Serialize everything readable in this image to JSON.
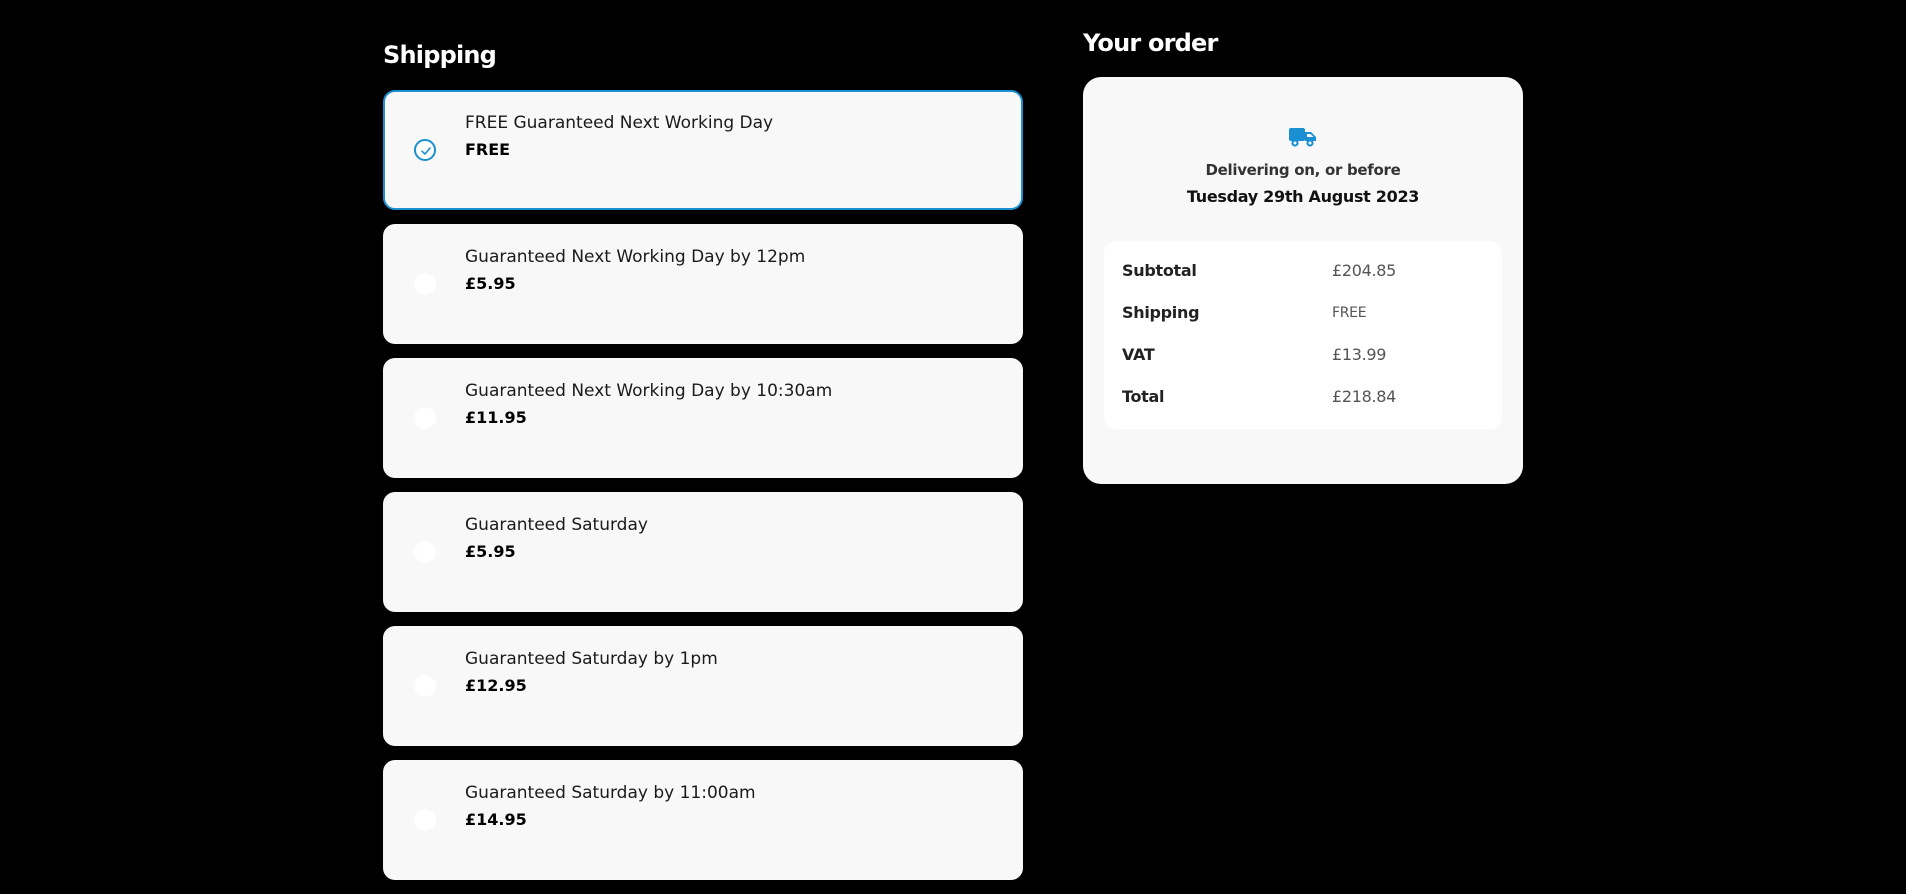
{
  "shipping": {
    "title": "Shipping",
    "options": [
      {
        "label": "FREE Guaranteed Next Working Day",
        "price": "FREE",
        "selected": true
      },
      {
        "label": "Guaranteed Next Working Day by 12pm",
        "price": "£5.95",
        "selected": false
      },
      {
        "label": "Guaranteed Next Working Day by 10:30am",
        "price": "£11.95",
        "selected": false
      },
      {
        "label": "Guaranteed Saturday",
        "price": "£5.95",
        "selected": false
      },
      {
        "label": "Guaranteed Saturday by 1pm",
        "price": "£12.95",
        "selected": false
      },
      {
        "label": "Guaranteed Saturday by 11:00am",
        "price": "£14.95",
        "selected": false
      }
    ]
  },
  "order": {
    "title": "Your order",
    "delivery_icon": "truck-icon",
    "delivering_text": "Delivering on, or before",
    "delivery_date": "Tuesday 29th August 2023",
    "totals": {
      "subtotal_label": "Subtotal",
      "subtotal_value": "£204.85",
      "shipping_label": "Shipping",
      "shipping_value": "FREE",
      "vat_label": "VAT",
      "vat_value": "£13.99",
      "total_label": "Total",
      "total_value": "£218.84"
    }
  },
  "colors": {
    "background": "#000000",
    "card": "#f8f8f8",
    "accent": "#1a8fd1"
  }
}
